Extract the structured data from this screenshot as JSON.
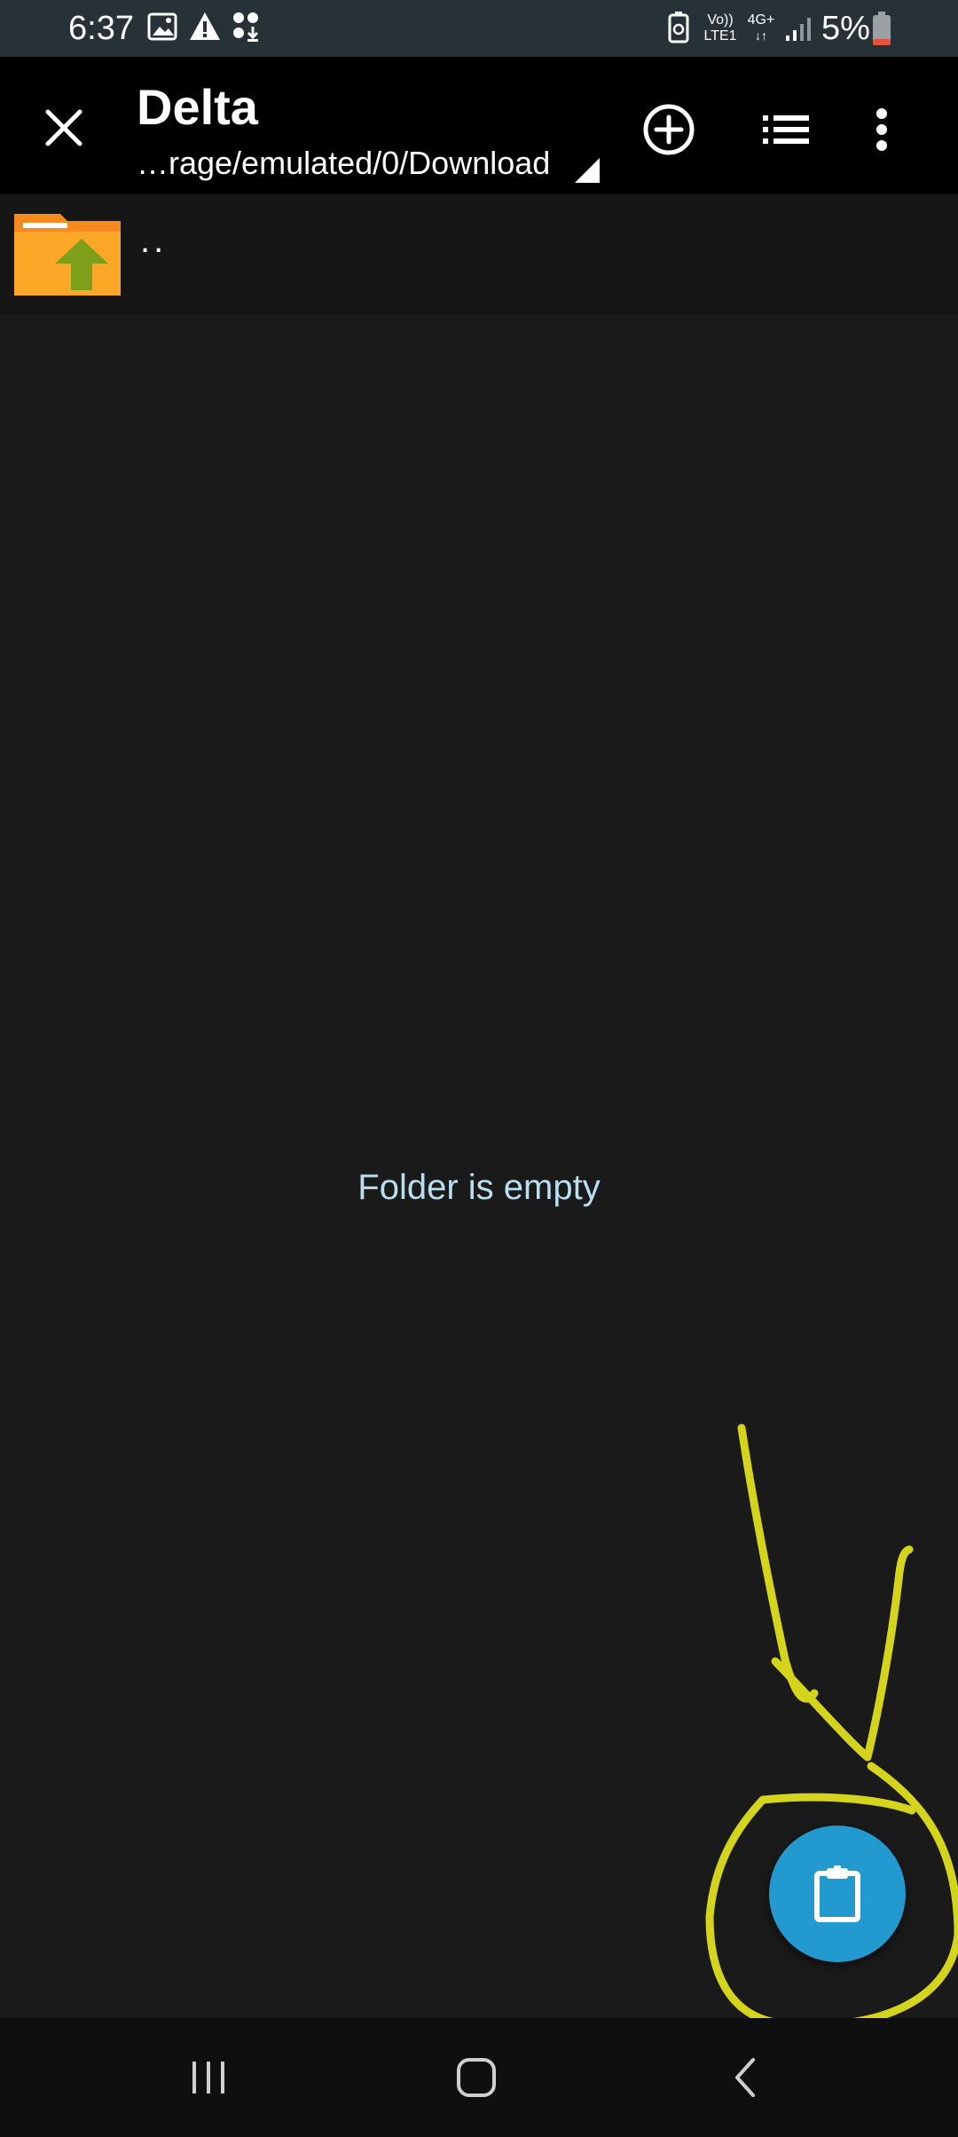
{
  "status_bar": {
    "time": "6:37",
    "battery_percent": "5%",
    "network_top": "Vo))",
    "network_bottom": "LTE1",
    "network_type": "4G+",
    "icons": [
      "gallery-icon",
      "warning-icon",
      "download-icon",
      "battery-saver-icon",
      "signal-icon",
      "battery-icon"
    ],
    "battery_color": "#e5533d"
  },
  "app_bar": {
    "title": "Delta",
    "path": "…rage/emulated/0/Download",
    "icons": [
      "close-icon",
      "add-circle-icon",
      "list-view-icon",
      "more-vert-icon"
    ]
  },
  "file_list": {
    "parent_label": ".."
  },
  "empty_message": "Folder is empty",
  "fab": {
    "icon": "clipboard-paste-icon",
    "color": "#229ad0"
  },
  "nav_bar": {
    "icons": [
      "recents-icon",
      "home-icon",
      "back-icon"
    ]
  },
  "annotation": {
    "color": "#d4d41c",
    "shapes": [
      "arrow",
      "circle"
    ]
  }
}
